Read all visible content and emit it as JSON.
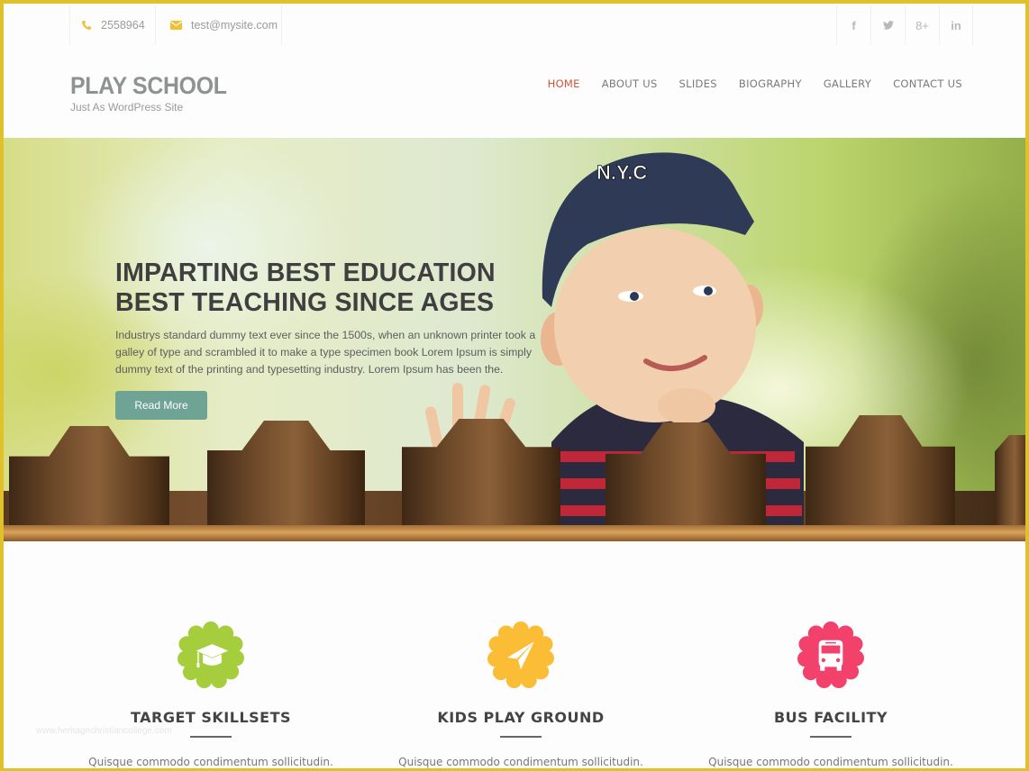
{
  "topbar": {
    "phone": "2558964",
    "email": "test@mysite.com",
    "social": [
      {
        "name": "facebook",
        "glyph": "f"
      },
      {
        "name": "twitter",
        "glyph": "❱"
      },
      {
        "name": "google-plus",
        "glyph": "8+"
      },
      {
        "name": "linkedin",
        "glyph": "in"
      }
    ]
  },
  "header": {
    "site_title": "PLAY SCHOOL",
    "tagline": "Just As WordPress Site",
    "nav": [
      {
        "label": "HOME",
        "active": true
      },
      {
        "label": "ABOUT US",
        "active": false
      },
      {
        "label": "SLIDES",
        "active": false
      },
      {
        "label": "BIOGRAPHY",
        "active": false
      },
      {
        "label": "GALLERY",
        "active": false
      },
      {
        "label": "CONTACT US",
        "active": false
      }
    ]
  },
  "hero": {
    "title_line1": "IMPARTING BEST EDUCATION",
    "title_line2": "BEST TEACHING SINCE AGES",
    "text": "Industrys standard dummy text ever since the 1500s, when an unknown printer took a galley of type and scrambled it to make a type specimen book Lorem Ipsum is simply dummy text of the printing and typesetting industry. Lorem Ipsum has been the.",
    "button": "Read More",
    "image_alt": "Smiling boy in N.Y.C cap peeking over wooden fence",
    "cap_text": "N.Y.C"
  },
  "features": [
    {
      "title": "TARGET SKILLSETS",
      "text": "Quisque commodo condimentum sollicitudin.",
      "icon": "graduation-cap-icon",
      "color": "#a5cd3c"
    },
    {
      "title": "KIDS PLAY GROUND",
      "text": "Quisque commodo condimentum sollicitudin.",
      "icon": "paper-plane-icon",
      "color": "#fbbd36"
    },
    {
      "title": "BUS FACILITY",
      "text": "Quisque commodo condimentum sollicitudin.",
      "icon": "bus-icon",
      "color": "#f2416a"
    }
  ],
  "watermark": "www.heritagechristiancollege.com",
  "colors": {
    "frame": "#e1c12a",
    "nav_active": "#d8513a",
    "button": "#6fa494",
    "contact_icon": "#f0c030"
  }
}
